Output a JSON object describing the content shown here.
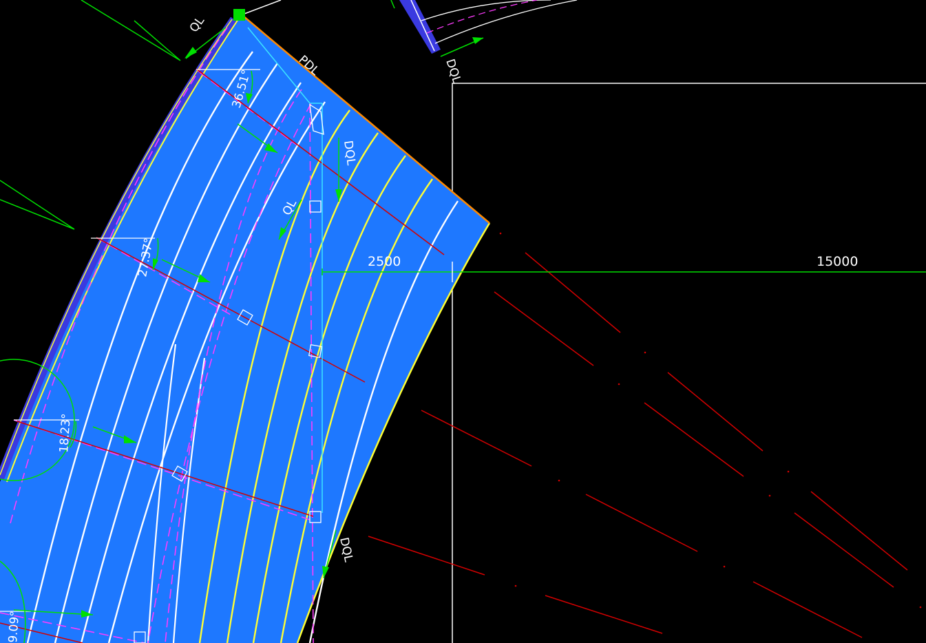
{
  "drawing": {
    "dimensions": {
      "main_label": "2500",
      "right_label": "15000"
    },
    "angles": [
      "36.51°",
      "27.37°",
      "18.23°",
      "9.09°"
    ],
    "text_labels": {
      "ql_top": "QL",
      "pdl_top": "PDL",
      "dql_top_right": "DQL",
      "dql_middle": "DQL",
      "ql_middle": "QL",
      "dql_bottom": "DQL"
    },
    "colors": {
      "background": "#000000",
      "ramp_fill": "#1e78ff",
      "contour_white": "#ffffff",
      "contour_yellow": "#ffff33",
      "edge_band": "#3a3ae0",
      "red_lines": "#d40000",
      "green_lines": "#00e000",
      "magenta_dash": "#ff3cff",
      "cyan_line": "#3ce6ff",
      "orange_edge": "#ff8a00"
    }
  }
}
